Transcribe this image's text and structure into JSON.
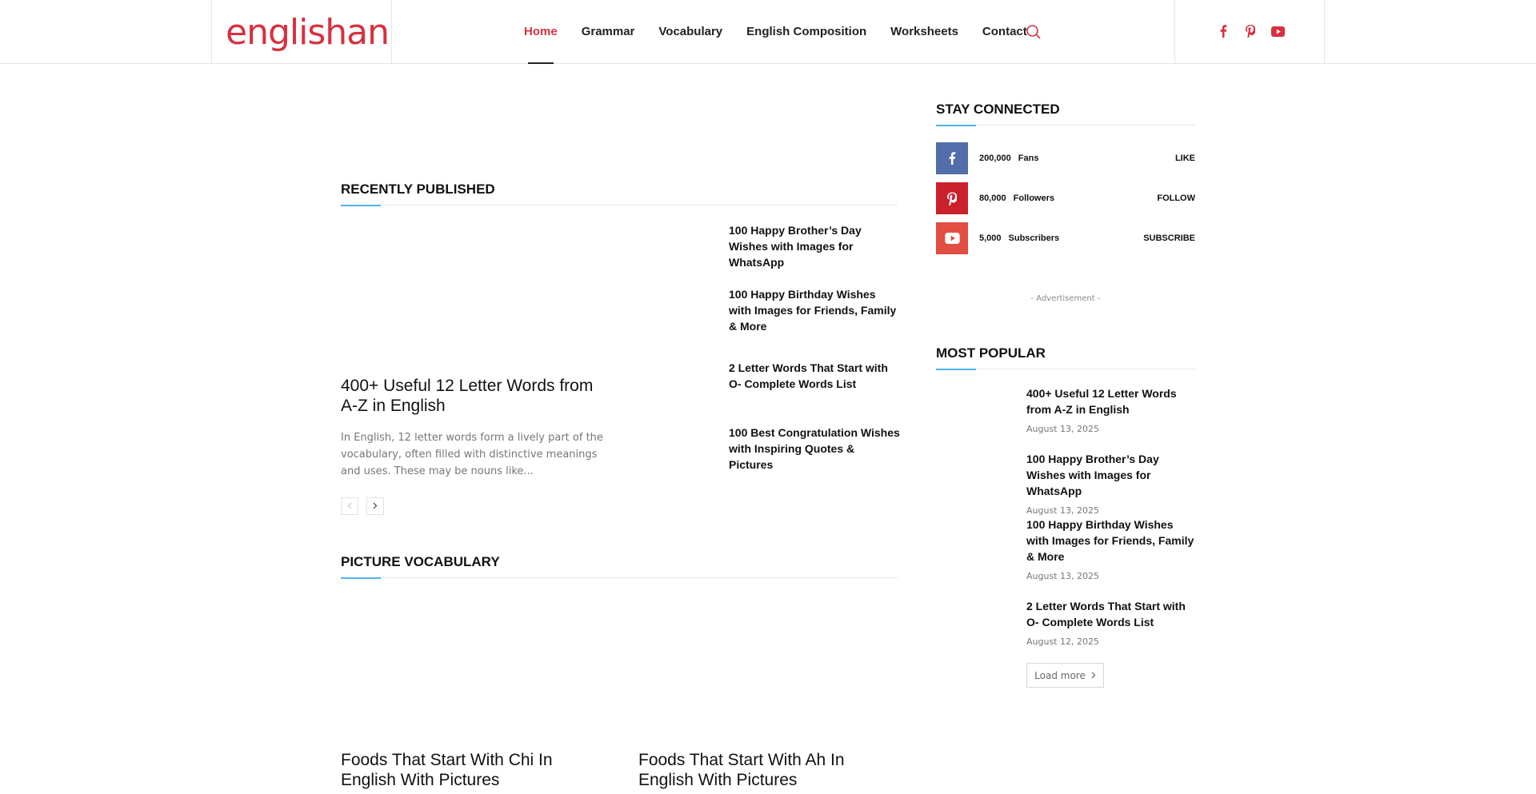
{
  "header": {
    "logo_text": "englishan",
    "nav": [
      "Home",
      "Grammar",
      "Vocabulary",
      "English Composition",
      "Worksheets",
      "Contact"
    ],
    "active_nav": "Home",
    "search_icon": "search-icon",
    "social_icons": [
      "facebook-icon",
      "pinterest-icon",
      "youtube-icon"
    ],
    "brand_color": "#d8303f"
  },
  "recently_published": {
    "heading": "RECENTLY PUBLISHED",
    "main_post": {
      "title": "400+ Useful 12 Letter Words from A-Z in English",
      "excerpt": "In English, 12 letter words form a lively part of the vocabulary, often filled with distinctive meanings and uses. These may be nouns like..."
    },
    "side_posts": [
      "100 Happy Brother’s Day Wishes with Images for WhatsApp",
      "100 Happy Birthday Wishes with Images for Friends, Family & More",
      "2 Letter Words That Start with O- Complete Words List",
      "100 Best Congratulation Wishes with Inspiring Quotes & Pictures"
    ],
    "prev_icon": "chevron-left-icon",
    "next_icon": "chevron-right-icon"
  },
  "picture_vocabulary": {
    "heading": "PICTURE VOCABULARY",
    "posts": [
      "Foods That Start With Chi In English With Pictures",
      "Foods That Start With Ah In English With Pictures"
    ]
  },
  "stay_connected": {
    "heading": "STAY CONNECTED",
    "rows": [
      {
        "icon": "facebook-icon",
        "color": "#516eab",
        "count": "200,000",
        "label": "Fans",
        "action": "LIKE"
      },
      {
        "icon": "pinterest-icon",
        "color": "#ca212a",
        "count": "80,000",
        "label": "Followers",
        "action": "FOLLOW"
      },
      {
        "icon": "youtube-icon",
        "color": "#e14e42",
        "count": "5,000",
        "label": "Subscribers",
        "action": "SUBSCRIBE"
      }
    ]
  },
  "advertisement": "- Advertisement -",
  "most_popular": {
    "heading": "MOST POPULAR",
    "items": [
      {
        "title": "400+ Useful 12 Letter Words from A-Z in English",
        "date": "August 13, 2025"
      },
      {
        "title": "100 Happy Brother’s Day Wishes with Images for WhatsApp",
        "date": "August 13, 2025"
      },
      {
        "title": "100 Happy Birthday Wishes with Images for Friends, Family & More",
        "date": "August 13, 2025"
      },
      {
        "title": "2 Letter Words That Start with O- Complete Words List",
        "date": "August 12, 2025"
      }
    ],
    "load_more": "Load more"
  },
  "accent_color": "#4db2ec"
}
